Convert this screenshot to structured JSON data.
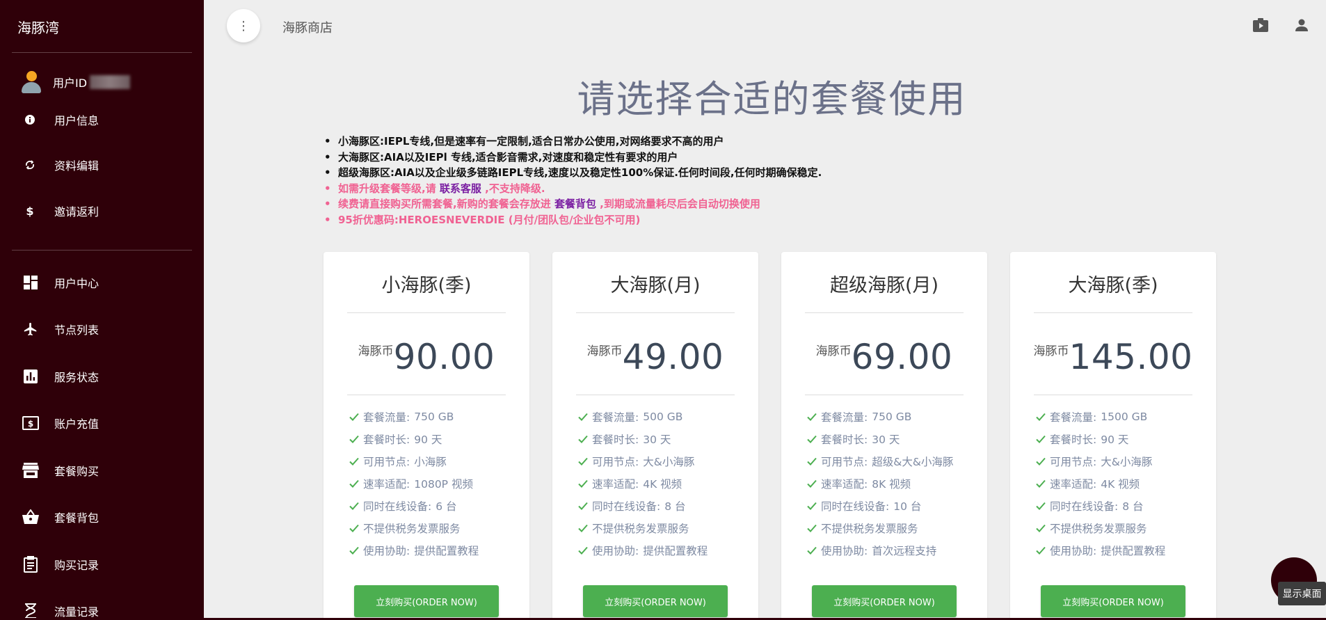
{
  "sidebar": {
    "brand": "海豚湾",
    "user_label": "用户ID",
    "items_top": [
      {
        "label": "用户信息",
        "icon": "info-icon"
      },
      {
        "label": "资料编辑",
        "icon": "sync-icon"
      },
      {
        "label": "邀请返利",
        "icon": "dollar-icon"
      }
    ],
    "items_main": [
      {
        "label": "用户中心",
        "icon": "dashboard-icon"
      },
      {
        "label": "节点列表",
        "icon": "airplane-icon"
      },
      {
        "label": "服务状态",
        "icon": "bar-chart-icon"
      },
      {
        "label": "账户充值",
        "icon": "money-icon"
      },
      {
        "label": "套餐购买",
        "icon": "store-icon"
      },
      {
        "label": "套餐背包",
        "icon": "basket-icon"
      },
      {
        "label": "购买记录",
        "icon": "clipboard-icon"
      },
      {
        "label": "流量记录",
        "icon": "hourglass-icon"
      }
    ]
  },
  "header": {
    "crumb": "海豚商店",
    "icons": [
      "video-store-icon",
      "account-icon"
    ]
  },
  "headline": "请选择合适的套餐使用",
  "bullets": {
    "line1": "小海豚区:IEPL专线,但是速率有一定限制,适合日常办公使用,对网络要求不高的用户",
    "line2": "大海豚区:AIA以及IEPl 专线,适合影音需求,对速度和稳定性有要求的用户",
    "line3": "超级海豚区:AIA以及企业级多链路IEPL专线,速度以及稳定性100%保证.任何时间段,任何时期确保稳定.",
    "line4_a": "如需升级套餐等级,请 ",
    "line4_link": "联系客服",
    "line4_b": " ,不支持降级.",
    "line5_a": "续费请直接购买所需套餐,新购的套餐会存放进 ",
    "line5_link": "套餐背包",
    "line5_b": " ,到期或流量耗尽后会自动切换使用",
    "line6": "95折优惠码:HEROESNEVERDIE (月付/团队包/企业包不可用)"
  },
  "plans": [
    {
      "title": "小海豚(季)",
      "currency": "海豚币",
      "price": "90.00",
      "features": [
        {
          "k": "套餐流量:",
          "v": "750 GB"
        },
        {
          "k": "套餐时长:",
          "v": "90 天"
        },
        {
          "k": "可用节点:",
          "v": "小海豚"
        },
        {
          "k": "速率适配:",
          "v": "1080P 视频"
        },
        {
          "k": "同时在线设备:",
          "v": "6 台"
        },
        {
          "k": "不提供税务发票服务",
          "v": ""
        },
        {
          "k": "使用协助:",
          "v": "提供配置教程"
        }
      ],
      "button": "立刻购买(ORDER NOW)"
    },
    {
      "title": "大海豚(月)",
      "currency": "海豚币",
      "price": "49.00",
      "features": [
        {
          "k": "套餐流量:",
          "v": "500 GB"
        },
        {
          "k": "套餐时长:",
          "v": "30 天"
        },
        {
          "k": "可用节点:",
          "v": "大&小海豚"
        },
        {
          "k": "速率适配:",
          "v": "4K 视频"
        },
        {
          "k": "同时在线设备:",
          "v": "8 台"
        },
        {
          "k": "不提供税务发票服务",
          "v": ""
        },
        {
          "k": "使用协助:",
          "v": "提供配置教程"
        }
      ],
      "button": "立刻购买(ORDER NOW)"
    },
    {
      "title": "超级海豚(月)",
      "currency": "海豚币",
      "price": "69.00",
      "features": [
        {
          "k": "套餐流量:",
          "v": "750 GB"
        },
        {
          "k": "套餐时长:",
          "v": "30 天"
        },
        {
          "k": "可用节点:",
          "v": "超级&大&小海豚"
        },
        {
          "k": "速率适配:",
          "v": "8K 视频"
        },
        {
          "k": "同时在线设备:",
          "v": "10 台"
        },
        {
          "k": "不提供税务发票服务",
          "v": ""
        },
        {
          "k": "使用协助:",
          "v": "首次远程支持"
        }
      ],
      "button": "立刻购买(ORDER NOW)"
    },
    {
      "title": "大海豚(季)",
      "currency": "海豚币",
      "price": "145.00",
      "features": [
        {
          "k": "套餐流量:",
          "v": "1500 GB"
        },
        {
          "k": "套餐时长:",
          "v": "90 天"
        },
        {
          "k": "可用节点:",
          "v": "大&小海豚"
        },
        {
          "k": "速率适配:",
          "v": "4K 视频"
        },
        {
          "k": "同时在线设备:",
          "v": "8 台"
        },
        {
          "k": "不提供税务发票服务",
          "v": ""
        },
        {
          "k": "使用协助:",
          "v": "提供配置教程"
        }
      ],
      "button": "立刻购买(ORDER NOW)"
    }
  ],
  "floater_tip": "显示桌面",
  "colors": {
    "sidebar_bg": "#2f0009",
    "accent_green": "#4caf50",
    "headline": "#6b7189",
    "warning_pink": "#f06292",
    "link_purple": "#7b1fa2"
  }
}
